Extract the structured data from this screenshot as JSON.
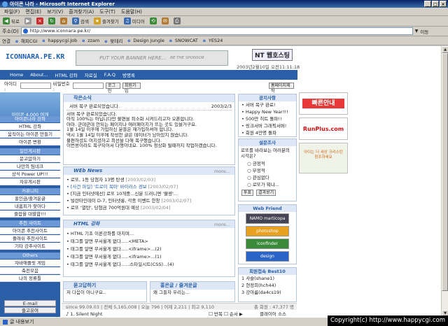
{
  "window": {
    "title": "아이콘 나라 - Microsoft Internet Explorer"
  },
  "menu": [
    "파일(F)",
    "편집(E)",
    "보기(V)",
    "즐겨찾기(A)",
    "도구(T)",
    "도움말(H)"
  ],
  "toolbar": {
    "back": "뒤로",
    "search": "검색",
    "favorites": "즐겨찾기",
    "media": "미디어"
  },
  "address": {
    "label": "주소(D)",
    "url": "http://www.iconnara.pe.kr/",
    "go": "이동"
  },
  "links": {
    "label": "연결",
    "items": [
      "해피CGI",
      "happycgi.Job",
      "zzam",
      "맞테리",
      "Design Jungle",
      "SNOWCAT",
      "YES24"
    ]
  },
  "site": {
    "logo": "ICONNARA.PE.KR",
    "banner_text": "PUT YOUR BANNER HERE...",
    "banner_sub": "BE THE SPONSOR",
    "nt": "NT 웹호스팅",
    "date": "2003년2월10일 오전11:11:18",
    "nav": [
      "Home",
      "About...",
      "HTML 강좌",
      "자료실",
      "F.A.Q",
      "방명록"
    ],
    "login": {
      "id": "아이디 :",
      "pw": "비밀번호 :",
      "login": "로그인",
      "join": "회원가입",
      "homepage": "홈페이지제작"
    },
    "visits": "아이콘 4,000 여개"
  },
  "left_sections": [
    {
      "title": "아이콘나라 강좌",
      "items": [
        "HTML 강좌",
        "움직이는 아이콘 만들기",
        "아이콘 변환"
      ]
    },
    {
      "title": "일인게시판",
      "items": [
        "문고맙하기",
        "나만의 팀네크",
        "상식 Power UP!!!",
        "자유게시판"
      ]
    },
    {
      "title": "커뮤니티",
      "items": [
        "홍인금/즐겨운글",
        "내홈피가 찾아다",
        "즐잡을 대할합!!!"
      ]
    },
    {
      "title": "추천 사이트",
      "items": [
        "아이콘 추천사이트",
        "플래쉬 추천사이트",
        "기타 강추사이트"
      ]
    },
    {
      "title": "Others",
      "items": [
        "자바애플릿 게임",
        "축전모음",
        "나의 정류틀"
      ]
    }
  ],
  "left_footer": {
    "email": "E-mail",
    "bookmark": "즐고유여"
  },
  "notice": {
    "title": "작은소식",
    "headline": "서버 복구 완료되었습니다.",
    "date": "2003/2/3",
    "body": [
      "서버 복구 완료되었습니다.",
      "아직 100%는 아닙니다만 불편을 최소화 시켜드리고자 오픈합니다.",
      "아마. 군데군데 안되는 페이지나 에러페이지가 뜨는 곳도 있을거구요.",
      "1월 14일 이후에 가입하신 분들은 재가입하셔야 합니다.",
      "역시 1월 14일 이후에 작성한 글은 데이터가 남아있지 않습니다.",
      "불편하셨도 여지셨하고 최선을 다해 복구했습니다.",
      "이번용이라도 복구되어서 다행이네요. 100% 정상화 될때까지 작업하겠습니다."
    ]
  },
  "webnews": {
    "title": "WEb News",
    "more": "more...",
    "items": [
      {
        "text": "로또, 1등 당첨자 13명 탄생",
        "date": "[2003/02/03]"
      },
      {
        "text": "[사건 파일] '트로이 목마' 바이러스 경보",
        "date": "[2003/02/07]"
      },
      {
        "text": "[지금 인터넷에선] 로또 10개중...신분 드러니면 '불량'...",
        "date": ""
      },
      {
        "text": "빌란타인데이 D-7, 인터넷롱, 각종 이벤트 한창",
        "date": "[2003/02/07]"
      },
      {
        "text": "로또 '열탄', 당첨금 700억원대 예상",
        "date": "[2003/02/04]"
      }
    ]
  },
  "html_course": {
    "title": "HTML 강좌",
    "more": "more...",
    "items": [
      "HTML 기초 이론강좌를 마치며...",
      "태그를 알면 무서울게 없다.....<META>",
      "태그를 알면 무서울게 없다.....<iframe>...(2)",
      "태그를 알면 무서울게 없다.....<iframe>...(1)",
      "태그를 알면 무서울게 없다......스타일시트(CSS)...(4)"
    ]
  },
  "bottom_boxes": [
    {
      "title": "묻고답하기",
      "item": "저 다음이 아니구요.."
    },
    {
      "title": "홍은글 / 즐겨운글",
      "item": "왜 그들차 우리는..."
    }
  ],
  "stats": {
    "since": "since 99.09.03",
    "total": "전체 5,165,008",
    "today": "오늘 796",
    "yesterday": "어제 2,211",
    "max": "최고 9,110",
    "members": "총 회원 : 47,377 명"
  },
  "marquee": "1. Silent Night",
  "guestbook": {
    "mode": "반복",
    "order": "순서",
    "count": "번째",
    "cross": "클래이어 소스"
  },
  "notice_right": {
    "title": "공지사항",
    "items": [
      "서버 복구 완료!",
      "Happy New Year!!!",
      "500만 히트 돌파!!",
      "링크서버 그래픽서버!",
      "회원 4만명 돌파"
    ]
  },
  "poll": {
    "title": "설문조사",
    "question": "로또를 바라보는 여러분의 시각은?",
    "options": [
      "긍정적",
      "부정적",
      "관심없다",
      "로또가 뭐냐..."
    ],
    "vote": "투표",
    "results": "결과보기"
  },
  "webfriend": {
    "title": "Web Friend",
    "items": [
      "NAMO marticopa",
      "photoshop",
      "iconfinder",
      "design"
    ]
  },
  "members": {
    "title": "회원접속 Best10",
    "items": [
      "1 사슬(shane1)",
      "2 현정희(hch44)",
      "3 강아름(da4cs19)"
    ]
  },
  "ads": [
    "빠른안내",
    "RunPlus.com",
    "아이는 더 세상 크리스턴 참조하세요"
  ],
  "status": {
    "text": "글 내용보기"
  },
  "copyright": "Copyright(c) http://www.happycgi.com",
  "colors": {
    "nav": "#2a5fa8",
    "accent": "#e8e0c0"
  }
}
